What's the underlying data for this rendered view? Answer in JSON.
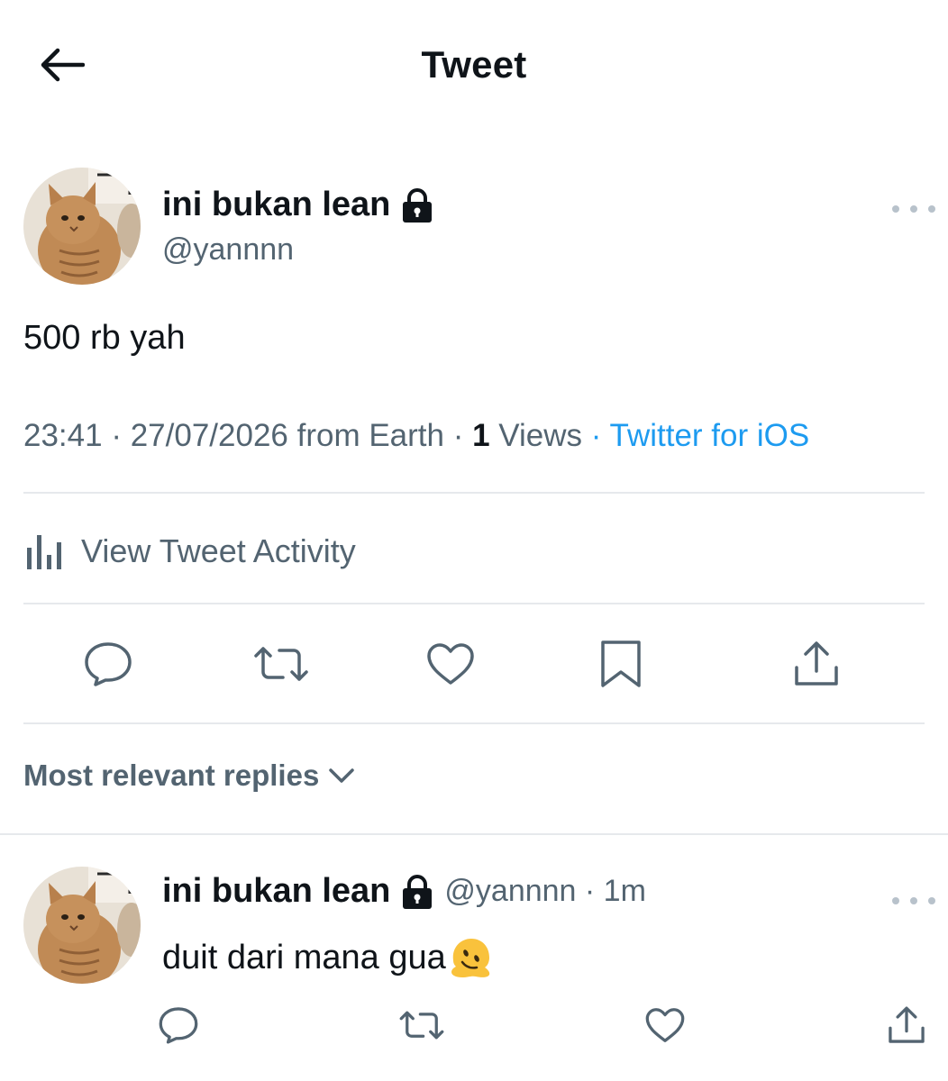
{
  "header": {
    "title": "Tweet",
    "back_icon": "arrow-left-icon"
  },
  "tweet": {
    "author": {
      "display_name": "ini bukan lean",
      "handle": "@yannnn",
      "lock_icon": "lock-icon",
      "avatar": "cat-avatar"
    },
    "text": "500 rb yah",
    "meta": {
      "time": "23:41",
      "sep1": " · ",
      "date": "27/07/2026",
      "location": " from Earth",
      "sep2": " · ",
      "views_count": "1",
      "views_label": " Views",
      "sep3": " · ",
      "source": "Twitter for iOS"
    },
    "activity_label": "View Tweet Activity",
    "actions": [
      "reply-icon",
      "retweet-icon",
      "like-icon",
      "bookmark-icon",
      "share-icon"
    ]
  },
  "replies": {
    "sort_label": "Most relevant replies",
    "items": [
      {
        "display_name": "ini bukan lean",
        "handle": "@yannnn",
        "time_sep": " · ",
        "time": "1m",
        "text": "duit dari mana gua",
        "emoji": "melting-face-emoji"
      }
    ]
  },
  "colors": {
    "text": "#0f1419",
    "secondary": "#536471",
    "accent": "#1d9bf0",
    "divider": "#e6e9ec"
  }
}
